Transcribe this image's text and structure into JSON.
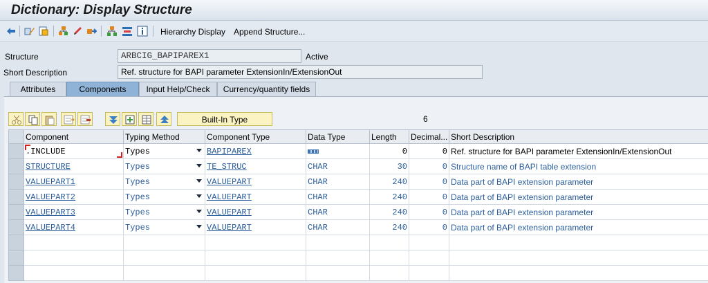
{
  "window": {
    "title": "Dictionary: Display Structure"
  },
  "toolbar": {
    "icons": [
      "back-icon",
      "display-change-icon",
      "other-object-icon",
      "where-used-icon",
      "pencil-icon",
      "navigate-icon",
      "hierarchy-icon",
      "object-list-icon",
      "info-icon"
    ],
    "hierarchy_display": "Hierarchy Display",
    "append_structure": "Append Structure..."
  },
  "header": {
    "structure_label": "Structure",
    "structure_value": "ARBCIG_BAPIPAREX1",
    "status": "Active",
    "short_desc_label": "Short Description",
    "short_desc_value": "Ref. structure for BAPI parameter ExtensionIn/ExtensionOut"
  },
  "tabs": [
    "Attributes",
    "Components",
    "Input Help/Check",
    "Currency/quantity fields"
  ],
  "active_tab": "Components",
  "grid_toolbar": {
    "buttons": [
      "cut-icon",
      "copy-icon",
      "paste-icon",
      "insert-row-icon",
      "delete-row-icon",
      "sort-down-icon",
      "new-row-icon",
      "table-icon",
      "sort-up-icon"
    ],
    "builtin_label": "Built-In Type",
    "count": "6"
  },
  "columns": [
    "Component",
    "Typing Method",
    "Component Type",
    "Data Type",
    "Length",
    "Decimal...",
    "Short Description"
  ],
  "rows": [
    {
      "component": ".INCLUDE",
      "typing": "Types",
      "comp_type": "BAPIPAREX",
      "data_type": "",
      "length": "0",
      "decimals": "0",
      "desc": "Ref. structure for BAPI parameter ExtensionIn/ExtensionOut"
    },
    {
      "component": "STRUCTURE",
      "typing": "Types",
      "comp_type": "TE_STRUC",
      "data_type": "CHAR",
      "length": "30",
      "decimals": "0",
      "desc": "Structure name of  BAPI table extension"
    },
    {
      "component": "VALUEPART1",
      "typing": "Types",
      "comp_type": "VALUEPART",
      "data_type": "CHAR",
      "length": "240",
      "decimals": "0",
      "desc": "Data part of BAPI extension parameter"
    },
    {
      "component": "VALUEPART2",
      "typing": "Types",
      "comp_type": "VALUEPART",
      "data_type": "CHAR",
      "length": "240",
      "decimals": "0",
      "desc": "Data part of BAPI extension parameter"
    },
    {
      "component": "VALUEPART3",
      "typing": "Types",
      "comp_type": "VALUEPART",
      "data_type": "CHAR",
      "length": "240",
      "decimals": "0",
      "desc": "Data part of BAPI extension parameter"
    },
    {
      "component": "VALUEPART4",
      "typing": "Types",
      "comp_type": "VALUEPART",
      "data_type": "CHAR",
      "length": "240",
      "decimals": "0",
      "desc": "Data part of BAPI extension parameter"
    }
  ],
  "colors": {
    "accent": "#2a5d9a",
    "active_tab": "#8fb3d6",
    "builtin_bg": "#fbf3c2"
  }
}
